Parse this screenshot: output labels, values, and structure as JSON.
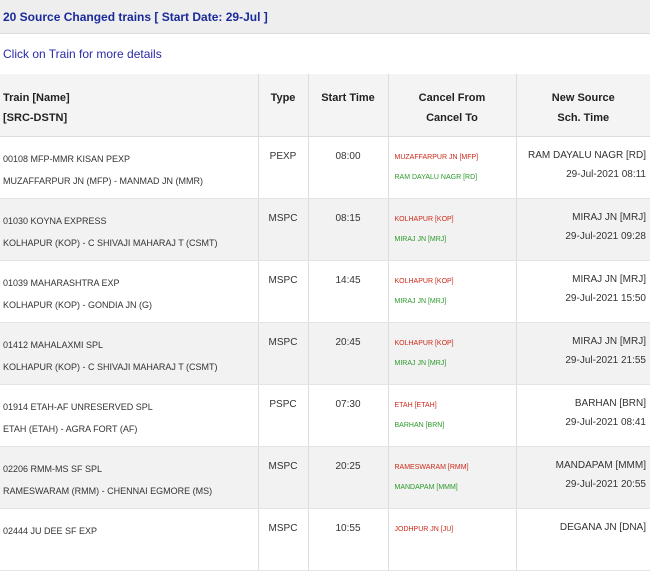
{
  "header": {
    "title": "20 Source Changed trains [ Start Date: 29-Jul ]",
    "hint": "Click on Train for more details"
  },
  "columns": {
    "train_line1": "Train [Name]",
    "train_line2": "[SRC-DSTN]",
    "type": "Type",
    "start_time": "Start Time",
    "cancel_line1": "Cancel From",
    "cancel_line2": "Cancel To",
    "newsrc_line1": "New Source",
    "newsrc_line2": "Sch. Time"
  },
  "rows": [
    {
      "train": "00108 MFP-MMR KISAN PEXP",
      "route": "MUZAFFARPUR JN (MFP) - MANMAD JN (MMR)",
      "type": "PEXP",
      "start": "08:00",
      "cancel_from": "MUZAFFARPUR JN [MFP]",
      "cancel_to": "RAM DAYALU NAGR [RD]",
      "new_source": "RAM DAYALU NAGR [RD]",
      "sch_time": "29-Jul-2021 08:11"
    },
    {
      "train": "01030 KOYNA EXPRESS",
      "route": "KOLHAPUR (KOP) - C SHIVAJI MAHARAJ T (CSMT)",
      "type": "MSPC",
      "start": "08:15",
      "cancel_from": "KOLHAPUR [KOP]",
      "cancel_to": "MIRAJ JN [MRJ]",
      "new_source": "MIRAJ JN [MRJ]",
      "sch_time": "29-Jul-2021 09:28"
    },
    {
      "train": "01039 MAHARASHTRA EXP",
      "route": "KOLHAPUR (KOP) - GONDIA JN (G)",
      "type": "MSPC",
      "start": "14:45",
      "cancel_from": "KOLHAPUR [KOP]",
      "cancel_to": "MIRAJ JN [MRJ]",
      "new_source": "MIRAJ JN [MRJ]",
      "sch_time": "29-Jul-2021 15:50"
    },
    {
      "train": "01412 MAHALAXMI SPL",
      "route": "KOLHAPUR (KOP) - C SHIVAJI MAHARAJ T (CSMT)",
      "type": "MSPC",
      "start": "20:45",
      "cancel_from": "KOLHAPUR [KOP]",
      "cancel_to": "MIRAJ JN [MRJ]",
      "new_source": "MIRAJ JN [MRJ]",
      "sch_time": "29-Jul-2021 21:55"
    },
    {
      "train": "01914 ETAH-AF UNRESERVED SPL",
      "route": "ETAH (ETAH) - AGRA FORT (AF)",
      "type": "PSPC",
      "start": "07:30",
      "cancel_from": "ETAH [ETAH]",
      "cancel_to": "BARHAN [BRN]",
      "new_source": "BARHAN [BRN]",
      "sch_time": "29-Jul-2021 08:41"
    },
    {
      "train": "02206 RMM-MS SF SPL",
      "route": "RAMESWARAM (RMM) - CHENNAI EGMORE (MS)",
      "type": "MSPC",
      "start": "20:25",
      "cancel_from": "RAMESWARAM [RMM]",
      "cancel_to": "MANDAPAM [MMM]",
      "new_source": "MANDAPAM [MMM]",
      "sch_time": "29-Jul-2021 20:55"
    },
    {
      "train": "02444 JU DEE SF EXP",
      "route": "",
      "type": "MSPC",
      "start": "10:55",
      "cancel_from": "JODHPUR JN [JU]",
      "cancel_to": "",
      "new_source": "DEGANA JN [DNA]",
      "sch_time": ""
    }
  ]
}
